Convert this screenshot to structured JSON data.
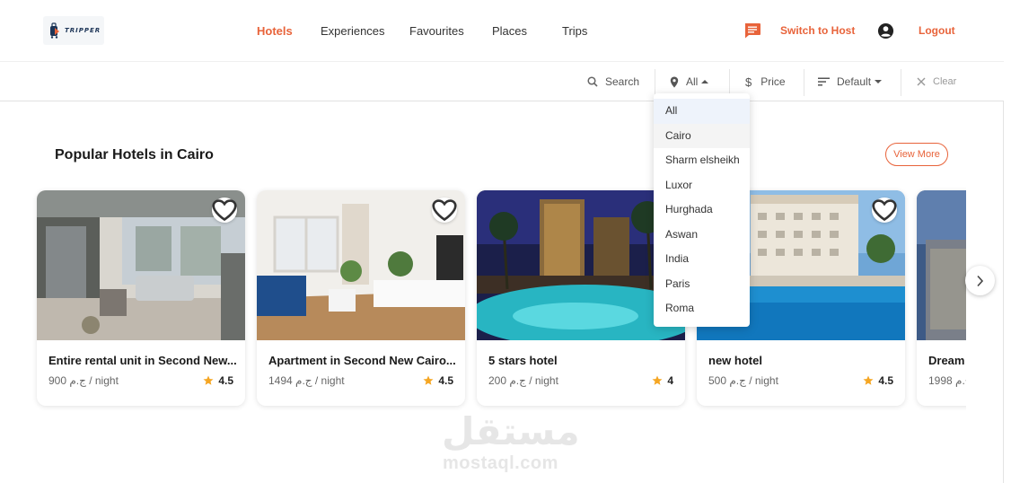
{
  "header": {
    "logo_text": "TRIPPER",
    "nav": [
      "Hotels",
      "Experiences",
      "Favourites",
      "Places",
      "Trips"
    ],
    "active_nav": "Hotels",
    "switch_host": "Switch to Host",
    "logout": "Logout"
  },
  "filters": {
    "search": "Search",
    "location": "All",
    "price": "Price",
    "sort": "Default",
    "clear": "Clear"
  },
  "dropdown": {
    "options": [
      "All",
      "Cairo",
      "Sharm elsheikh",
      "Luxor",
      "Hurghada",
      "Aswan",
      "India",
      "Paris",
      "Roma"
    ],
    "selected": "All",
    "hovered": "Cairo"
  },
  "section": {
    "title": "Popular Hotels in Cairo",
    "view_more": "View More"
  },
  "cards": [
    {
      "title": "Entire rental unit in Second New...",
      "price": "900 ج.م / night",
      "rating": "4.5"
    },
    {
      "title": "Apartment in Second New Cairo...",
      "price": "1494 ج.م / night",
      "rating": "4.5"
    },
    {
      "title": "5 stars hotel",
      "price": "200 ج.م / night",
      "rating": "4"
    },
    {
      "title": "new hotel",
      "price": "500 ج.م / night",
      "rating": "4.5"
    },
    {
      "title": "Dream",
      "price": "1998 ج.م",
      "rating": ""
    }
  ],
  "colors": {
    "accent": "#e8633a",
    "star": "#f5a623"
  },
  "watermark": {
    "arabic": "مستقل",
    "latin": "mostaql.com"
  }
}
